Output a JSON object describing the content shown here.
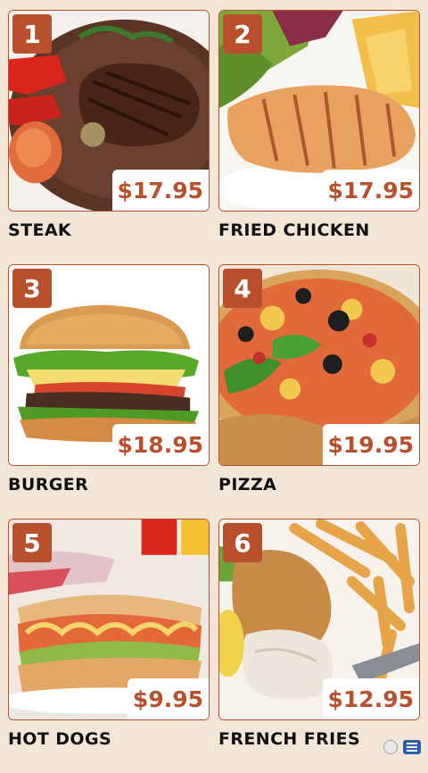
{
  "menu": {
    "items": [
      {
        "number": "1",
        "name": "STEAK",
        "price": "$17.95",
        "image": "steak-photo"
      },
      {
        "number": "2",
        "name": "FRIED CHICKEN",
        "price": "$17.95",
        "image": "chicken-photo"
      },
      {
        "number": "3",
        "name": "BURGER",
        "price": "$18.95",
        "image": "burger-photo"
      },
      {
        "number": "4",
        "name": "PIZZA",
        "price": "$19.95",
        "image": "pizza-photo"
      },
      {
        "number": "5",
        "name": "HOT DOGS",
        "price": "$9.95",
        "image": "hotdog-photo"
      },
      {
        "number": "6",
        "name": "FRENCH FRIES",
        "price": "$12.95",
        "image": "fish-fries-photo"
      }
    ]
  },
  "colors": {
    "accent": "#b8502d",
    "background": "#f3e6d6",
    "text": "#111111"
  },
  "icons": {
    "corner_left": "dots-icon",
    "corner_right": "menu-icon"
  }
}
